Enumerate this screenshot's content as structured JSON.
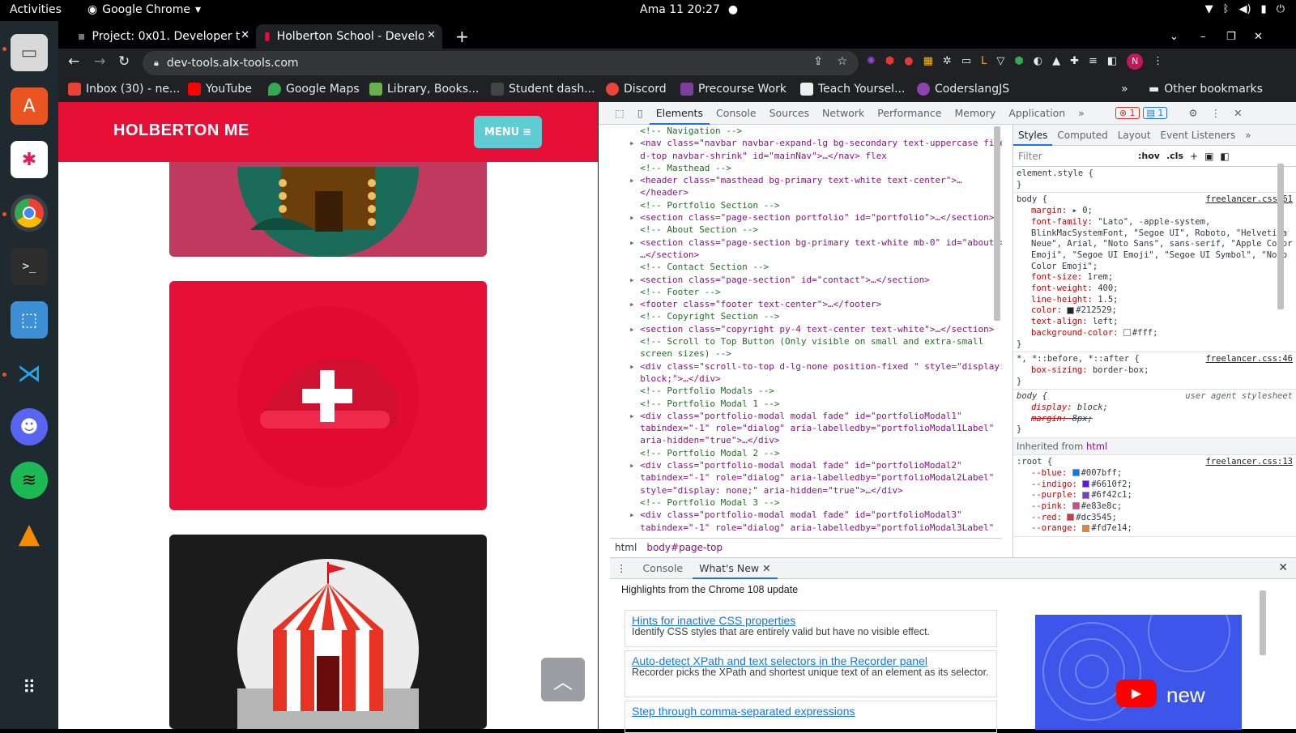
{
  "os": {
    "activities": "Activities",
    "app_name": "Google Chrome",
    "clock": "Ama 11  20:27"
  },
  "dock": [
    {
      "name": "files-icon"
    },
    {
      "name": "software-center-icon"
    },
    {
      "name": "slack-icon"
    },
    {
      "name": "chrome-icon"
    },
    {
      "name": "terminal-icon"
    },
    {
      "name": "screenshot-icon"
    },
    {
      "name": "vscode-icon"
    },
    {
      "name": "discord-icon"
    },
    {
      "name": "spotify-icon"
    },
    {
      "name": "vlc-icon"
    },
    {
      "name": "app-grid-icon"
    }
  ],
  "browser": {
    "tabs": [
      {
        "title": "Project: 0x01. Developer t"
      },
      {
        "title": "Holberton School - Develo"
      }
    ],
    "url": "dev-tools.alx-tools.com",
    "bookmarks": [
      {
        "label": "Inbox (30) - ne...",
        "color": "#ea4335"
      },
      {
        "label": "YouTube",
        "color": "#ff0000"
      },
      {
        "label": "Google Maps",
        "color": "#34a853"
      },
      {
        "label": "Library, Books...",
        "color": "#6ab04c"
      },
      {
        "label": "Student dash...",
        "color": "#444444"
      },
      {
        "label": "Discord",
        "color": "#e8453c"
      },
      {
        "label": "Precourse Work",
        "color": "#7b3fa0"
      },
      {
        "label": "Teach Yoursel...",
        "color": "#eeeeee"
      },
      {
        "label": "CoderslangJS",
        "color": "#8e44ad"
      }
    ],
    "other_bookmarks": "Other bookmarks",
    "profile_initial": "N"
  },
  "page": {
    "brand": "HOLBERTON ME",
    "menu": "MENU",
    "accent": "#e60f36"
  },
  "devtools": {
    "tabs": [
      "Elements",
      "Console",
      "Sources",
      "Network",
      "Performance",
      "Memory",
      "Application"
    ],
    "errors": "1",
    "messages": "1",
    "elements_lines": [
      {
        "t": "cm",
        "text": "<!-- Navigation -->"
      },
      {
        "t": "el",
        "text": "<nav class=\"navbar navbar-expand-lg bg-secondary text-uppercase fixe"
      },
      {
        "t": "cont",
        "text": "d-top navbar-shrink\" id=\"mainNav\">…</nav> flex"
      },
      {
        "t": "cm",
        "text": "<!-- Masthead -->"
      },
      {
        "t": "el",
        "text": "<header class=\"masthead bg-primary text-white text-center\">…"
      },
      {
        "t": "cont",
        "text": "</header>"
      },
      {
        "t": "cm",
        "text": "<!-- Portfolio Section -->"
      },
      {
        "t": "el",
        "text": "<section class=\"page-section portfolio\" id=\"portfolio\">…</section>"
      },
      {
        "t": "cm",
        "text": "<!-- About Section -->"
      },
      {
        "t": "el",
        "text": "<section class=\"page-section bg-primary text-white mb-0\" id=\"about\">"
      },
      {
        "t": "cont",
        "text": "…</section>"
      },
      {
        "t": "cm",
        "text": "<!-- Contact Section -->"
      },
      {
        "t": "el",
        "text": "<section class=\"page-section\" id=\"contact\">…</section>"
      },
      {
        "t": "cm",
        "text": "<!-- Footer -->"
      },
      {
        "t": "el",
        "text": "<footer class=\"footer text-center\">…</footer>"
      },
      {
        "t": "cm",
        "text": "<!-- Copyright Section -->"
      },
      {
        "t": "el",
        "text": "<section class=\"copyright py-4 text-center text-white\">…</section>"
      },
      {
        "t": "cm",
        "text": "<!-- Scroll to Top Button (Only visible on small and extra-small"
      },
      {
        "t": "cm",
        "text": "screen sizes) -->"
      },
      {
        "t": "el",
        "text": "<div class=\"scroll-to-top d-lg-none position-fixed \" style=\"display:"
      },
      {
        "t": "cont",
        "text": "block;\">…</div>"
      },
      {
        "t": "cm",
        "text": "<!-- Portfolio Modals -->"
      },
      {
        "t": "cm",
        "text": "<!-- Portfolio Modal 1 -->"
      },
      {
        "t": "el",
        "text": "<div class=\"portfolio-modal modal fade\" id=\"portfolioModal1\""
      },
      {
        "t": "cont",
        "text": "tabindex=\"-1\" role=\"dialog\" aria-labelledby=\"portfolioModal1Label\""
      },
      {
        "t": "cont",
        "text": "aria-hidden=\"true\">…</div>"
      },
      {
        "t": "cm",
        "text": "<!-- Portfolio Modal 2 -->"
      },
      {
        "t": "el",
        "text": "<div class=\"portfolio-modal modal fade\" id=\"portfolioModal2\""
      },
      {
        "t": "cont",
        "text": "tabindex=\"-1\" role=\"dialog\" aria-labelledby=\"portfolioModal2Label\""
      },
      {
        "t": "cont",
        "text": "style=\"display: none;\" aria-hidden=\"true\">…</div>"
      },
      {
        "t": "cm",
        "text": "<!-- Portfolio Modal 3 -->"
      },
      {
        "t": "el",
        "text": "<div class=\"portfolio-modal modal fade\" id=\"portfolioModal3\""
      },
      {
        "t": "cont",
        "text": "tabindex=\"-1\" role=\"dialog\" aria-labelledby=\"portfolioModal3Label\""
      }
    ],
    "crumbs": [
      "html",
      "body#page-top"
    ],
    "styles_tabs": [
      "Styles",
      "Computed",
      "Layout",
      "Event Listeners"
    ],
    "filter_placeholder": "Filter",
    "hov": ":hov",
    "cls": ".cls",
    "rules": [
      {
        "selector": "element.style {",
        "source": "",
        "props": [],
        "close": "}"
      },
      {
        "selector": "body {",
        "source": "freelancer.css:61",
        "props": [
          {
            "n": "margin",
            "v": "▸ 0;"
          },
          {
            "n": "font-family",
            "v": "\"Lato\", -apple-system, BlinkMacSystemFont, \"Segoe UI\", Roboto, \"Helvetica Neue\", Arial, \"Noto Sans\", sans-serif, \"Apple Color Emoji\", \"Segoe UI Emoji\", \"Segoe UI Symbol\", \"Noto Color Emoji\";"
          },
          {
            "n": "font-size",
            "v": "1rem;"
          },
          {
            "n": "font-weight",
            "v": "400;"
          },
          {
            "n": "line-height",
            "v": "1.5;"
          },
          {
            "n": "color",
            "v": "#212529;",
            "swatch": "#212529"
          },
          {
            "n": "text-align",
            "v": "left;"
          },
          {
            "n": "background-color",
            "v": "#fff;",
            "swatch": "#ffffff"
          }
        ],
        "close": "}"
      },
      {
        "selector": "*, *::before, *::after {",
        "source": "freelancer.css:46",
        "props": [
          {
            "n": "box-sizing",
            "v": "border-box;"
          }
        ],
        "close": "}"
      },
      {
        "selector": "body {",
        "source": "user agent stylesheet",
        "props": [
          {
            "n": "display",
            "v": "block;"
          },
          {
            "n": "margin:",
            "v": "8px;"
          }
        ],
        "close": "}"
      }
    ],
    "inherited_label": "Inherited from",
    "inherited_from": "html",
    "root_rule": {
      "selector": ":root {",
      "source": "freelancer.css:13",
      "props": [
        {
          "n": "--blue",
          "v": "#007bff;",
          "swatch": "#007bff"
        },
        {
          "n": "--indigo",
          "v": "#6610f2;",
          "swatch": "#6610f2"
        },
        {
          "n": "--purple",
          "v": "#6f42c1;",
          "swatch": "#6f42c1"
        },
        {
          "n": "--pink",
          "v": "#e83e8c;",
          "swatch": "#e83e8c"
        },
        {
          "n": "--red",
          "v": "#dc3545;",
          "swatch": "#dc3545"
        },
        {
          "n": "--orange",
          "v": "#fd7e14;",
          "swatch": "#fd7e14"
        }
      ]
    },
    "drawer_tabs": [
      "Console",
      "What's New"
    ],
    "highlights": "Highlights from the Chrome 108 update",
    "whatsnew": [
      {
        "title": "Hints for inactive CSS properties",
        "desc": "Identify CSS styles that are entirely valid but have no visible effect."
      },
      {
        "title": "Auto-detect XPath and text selectors in the Recorder panel",
        "desc": "Recorder picks the XPath and shortest unique text of an element as its selector."
      },
      {
        "title": "Step through comma-separated expressions",
        "desc": ""
      }
    ],
    "video_label": "new"
  }
}
